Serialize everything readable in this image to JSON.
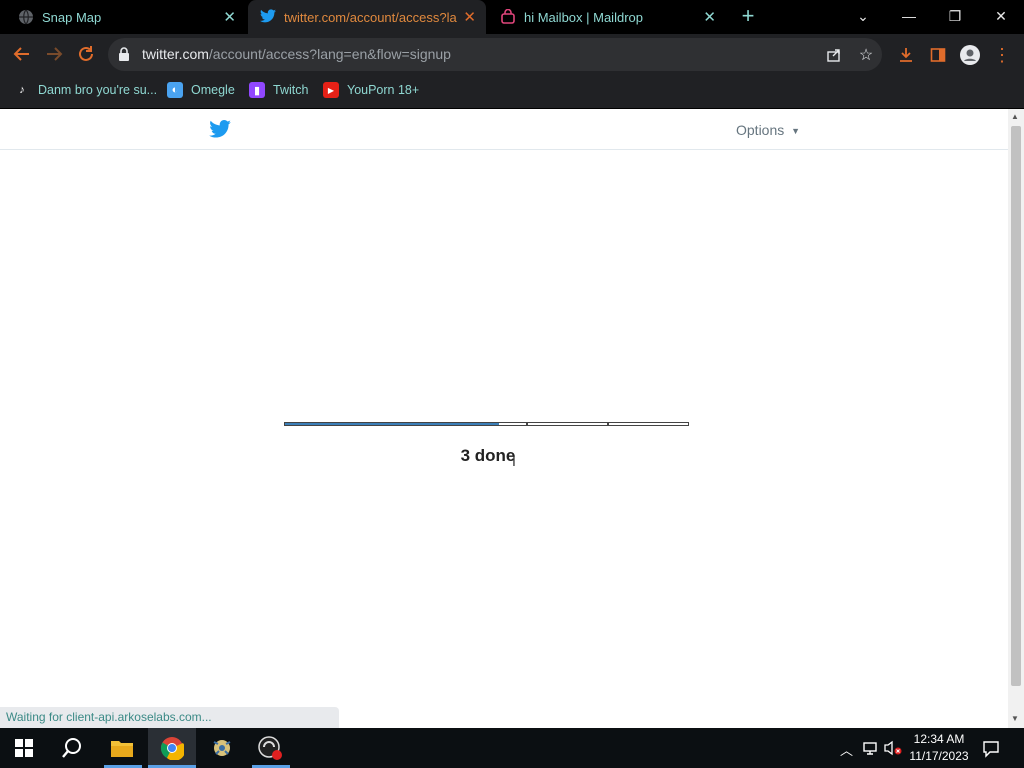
{
  "tabs": [
    {
      "title": "Snap Map",
      "icon": "globe-icon",
      "active": false
    },
    {
      "title": "twitter.com/account/access?lang=en&flow=signup",
      "icon": "twitter-icon",
      "active": true
    },
    {
      "title": "hi Mailbox | Maildrop",
      "icon": "maildrop-icon",
      "active": false
    }
  ],
  "new_tab_label": "+",
  "window_controls": {
    "chevron": "⌄",
    "minimize": "—",
    "restore": "❐",
    "close": "✕"
  },
  "address_bar": {
    "host": "twitter.com",
    "path": "/account/access?lang=en&flow=signup"
  },
  "bookmarks": [
    {
      "label": "Danm bro you're su...",
      "icon": "tiktok-icon"
    },
    {
      "label": "Omegle",
      "icon": "omegle-icon"
    },
    {
      "label": "Twitch",
      "icon": "twitch-icon"
    },
    {
      "label": "YouPorn 18+",
      "icon": "youtube-style-icon"
    }
  ],
  "page": {
    "options_label": "Options",
    "progress_done": 3,
    "progress_total": 5,
    "status_text": "3 done"
  },
  "status_bar": "Waiting for client-api.arkoselabs.com...",
  "clock": {
    "time": "12:34 AM",
    "date": "11/17/2023"
  },
  "colors": {
    "twitter_blue": "#1d9bf0",
    "progress_fill": "#3b7fb8",
    "tab_accent": "#e06c2b",
    "tab_text": "#8fd8d2"
  }
}
